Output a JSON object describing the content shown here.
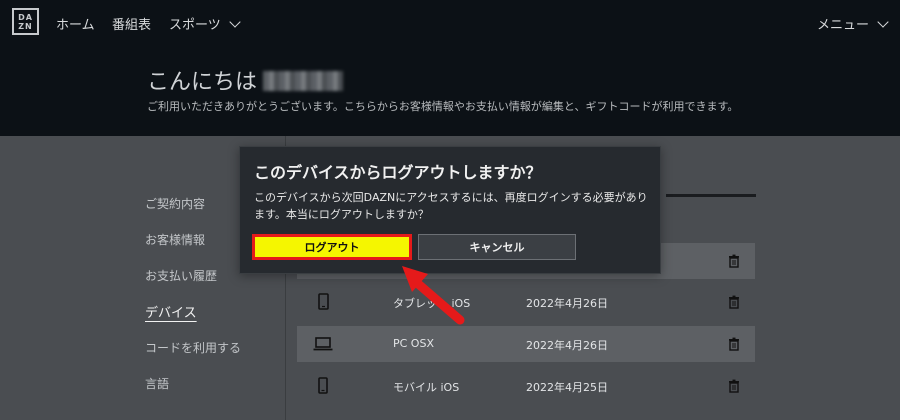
{
  "nav": {
    "logo_top": "DA",
    "logo_bottom": "ZN",
    "home": "ホーム",
    "schedule": "番組表",
    "sports": "スポーツ",
    "menu": "メニュー"
  },
  "header": {
    "greeting": "こんにちは",
    "subtitle": "ご利用いただきありがとうございます。こちらからお客様情報やお支払い情報が編集と、ギフトコードが利用できます。"
  },
  "sidebar": {
    "items": [
      {
        "label": "ご契約内容"
      },
      {
        "label": "お客様情報"
      },
      {
        "label": "お支払い履歴"
      },
      {
        "label": "デバイス"
      },
      {
        "label": "コードを利用する"
      },
      {
        "label": "言語"
      }
    ]
  },
  "devices": [
    {
      "name": "タブレット iOS",
      "date": "2022年4月26日",
      "icon": "tablet-icon"
    },
    {
      "name": "PC OSX",
      "date": "2022年4月26日",
      "icon": "laptop-icon"
    },
    {
      "name": "モバイル iOS",
      "date": "2022年4月25日",
      "icon": "mobile-icon"
    }
  ],
  "modal": {
    "title": "このデバイスからログアウトしますか？",
    "body": "このデバイスから次回DAZNにアクセスするには、再度ログインする必要があります。本当にログアウトしますか？",
    "logout_label": "ログアウト",
    "cancel_label": "キャンセル"
  },
  "colors": {
    "logout_button": "#f5f600",
    "highlight_border": "#e51a1a",
    "nav_bg": "#0c1116"
  }
}
